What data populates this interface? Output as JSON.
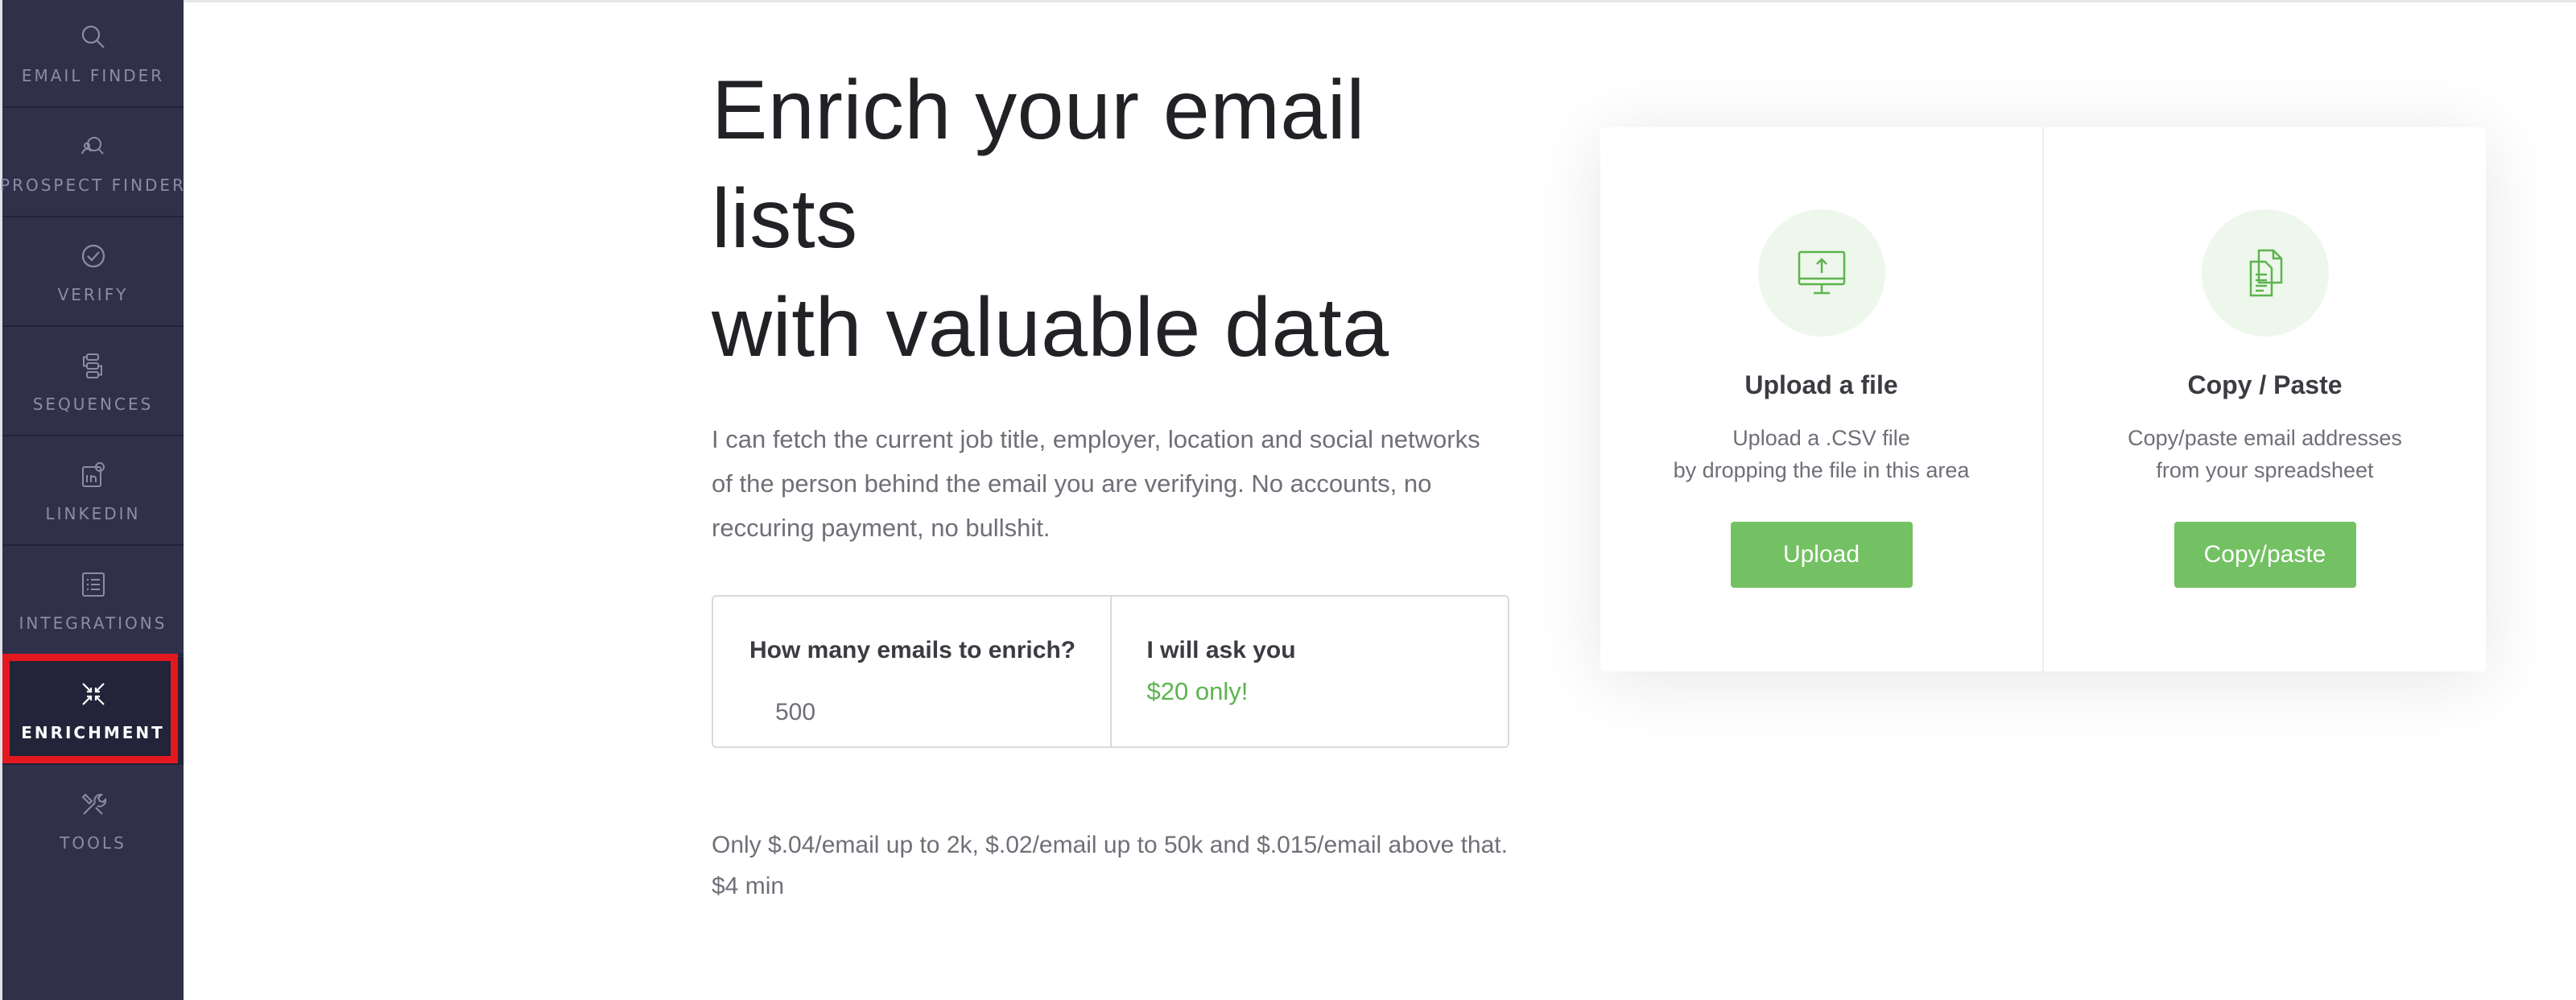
{
  "sidebar": {
    "items": [
      {
        "label": "EMAIL FINDER",
        "icon": "search-icon",
        "active": false
      },
      {
        "label": "PROSPECT FINDER",
        "icon": "prospect-search-icon",
        "active": false
      },
      {
        "label": "VERIFY",
        "icon": "check-circle-icon",
        "active": false
      },
      {
        "label": "SEQUENCES",
        "icon": "sequences-icon",
        "active": false
      },
      {
        "label": "LINKEDIN",
        "icon": "linkedin-icon",
        "active": false
      },
      {
        "label": "INTEGRATIONS",
        "icon": "integrations-icon",
        "active": false
      },
      {
        "label": "ENRICHMENT",
        "icon": "enrichment-icon",
        "active": true
      },
      {
        "label": "TOOLS",
        "icon": "tools-icon",
        "active": false
      }
    ]
  },
  "main": {
    "headline": {
      "line1": "Enrich your email",
      "line2": "lists",
      "line3": "with valuable data"
    },
    "intro": "I can fetch the current job title, employer, location and social networks of the person behind the email you are verifying. No accounts, no reccuring payment, no bullshit.",
    "calculator": {
      "question": "How many emails to enrich?",
      "quantity": "500",
      "ask_label": "I will ask you",
      "price": "$20 only!"
    },
    "pricing_note": "Only $.04/email up to 2k, $.02/email up to 50k and $.015/email above that. $4 min"
  },
  "card": {
    "upload": {
      "icon": "upload-monitor-icon",
      "title": "Upload a file",
      "desc_line1": "Upload a .CSV file",
      "desc_line2": "by dropping the file in this area",
      "button": "Upload"
    },
    "paste": {
      "icon": "copy-documents-icon",
      "title": "Copy / Paste",
      "desc_line1": "Copy/paste email addresses",
      "desc_line2": "from your spreadsheet",
      "button": "Copy/paste"
    }
  },
  "colors": {
    "sidebar_bg": "#30304a",
    "accent_green": "#73c163",
    "price_green": "#5cb34f",
    "highlight_red": "#e3191f"
  }
}
